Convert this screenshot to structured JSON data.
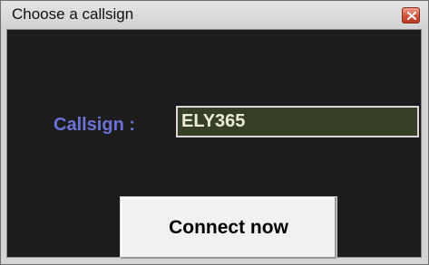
{
  "window": {
    "title": "Choose a callsign"
  },
  "form": {
    "callsign_label": "Callsign :",
    "callsign_value": "ELY365",
    "connect_label": "Connect now"
  },
  "icons": {
    "close": "close-icon"
  },
  "colors": {
    "client_background": "#1c1c1c",
    "label_text": "#6a72d6",
    "input_background": "#373f28",
    "close_button": "#d2533a"
  }
}
